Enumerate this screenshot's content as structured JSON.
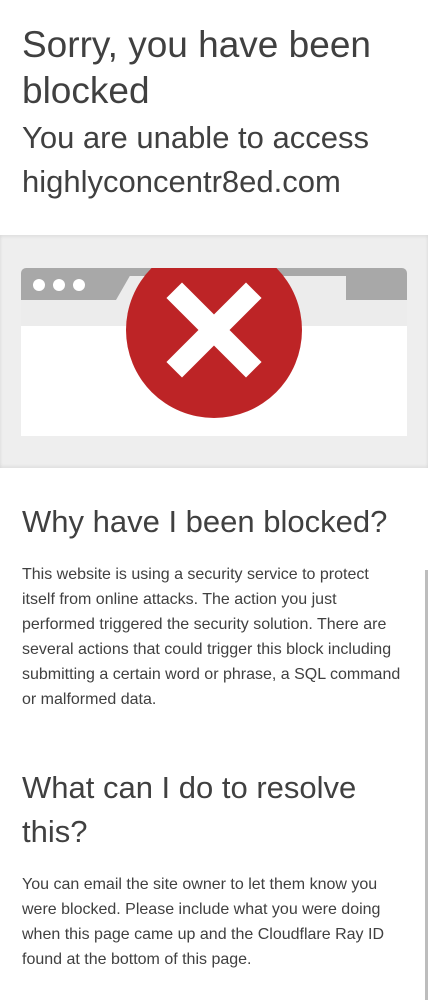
{
  "header": {
    "title": "Sorry, you have been blocked",
    "subtitle": "You are unable to access highlyconcentr8ed.com"
  },
  "illustration": {
    "icon": "block-x-icon",
    "icon_color": "#bd2426",
    "bar_color": "#a8a8a8",
    "background_color": "#eeeeee"
  },
  "why": {
    "heading": "Why have I been blocked?",
    "body": "This website is using a security service to protect itself from online attacks. The action you just performed triggered the security solution. There are several actions that could trigger this block including submitting a certain word or phrase, a SQL command or malformed data."
  },
  "resolve": {
    "heading": "What can I do to resolve this?",
    "body": "You can email the site owner to let them know you were blocked. Please include what you were doing when this page came up and the Cloudflare Ray ID found at the bottom of this page."
  }
}
